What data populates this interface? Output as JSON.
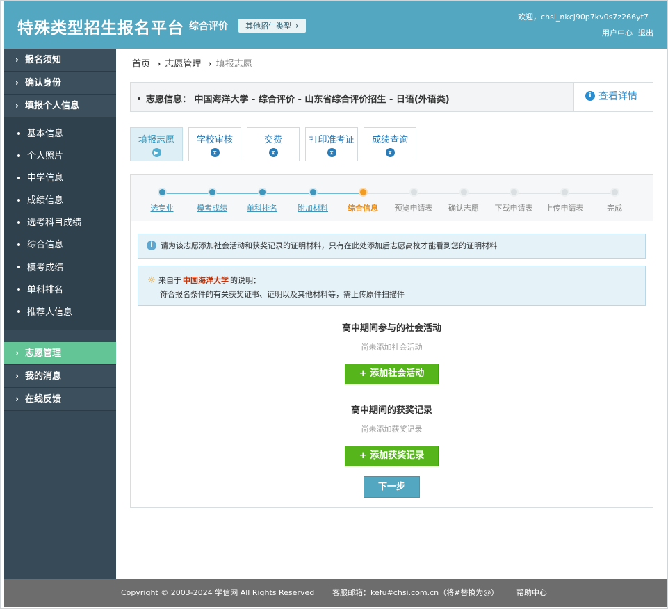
{
  "header": {
    "title": "特殊类型招生报名平台",
    "subtitle": "综合评价",
    "other_types": "其他招生类型",
    "welcome": "欢迎，chsi_nkcj90p7kv0s7z266yt7",
    "user_center": "用户中心",
    "logout": "退出"
  },
  "sidebar": {
    "top": [
      {
        "label": "报名须知"
      },
      {
        "label": "确认身份"
      },
      {
        "label": "填报个人信息"
      }
    ],
    "sub": [
      {
        "label": "基本信息"
      },
      {
        "label": "个人照片"
      },
      {
        "label": "中学信息"
      },
      {
        "label": "成绩信息"
      },
      {
        "label": "选考科目成绩"
      },
      {
        "label": "综合信息"
      },
      {
        "label": "模考成绩"
      },
      {
        "label": "单科排名"
      },
      {
        "label": "推荐人信息"
      }
    ],
    "bottom": [
      {
        "label": "志愿管理",
        "active": true
      },
      {
        "label": "我的消息"
      },
      {
        "label": "在线反馈"
      }
    ]
  },
  "breadcrumb": [
    "首页",
    "志愿管理",
    "填报志愿"
  ],
  "info_bar": {
    "text": "志愿信息： 中国海洋大学 - 综合评价 - 山东省综合评价招生 - 日语(外语类)",
    "detail": "查看详情"
  },
  "stage_tabs": [
    {
      "label": "填报志愿",
      "icon": "play-icon",
      "active": true
    },
    {
      "label": "学校审核",
      "icon": "hourglass-icon"
    },
    {
      "label": "交费",
      "icon": "hourglass-icon"
    },
    {
      "label": "打印准考证",
      "icon": "hourglass-icon"
    },
    {
      "label": "成绩查询",
      "icon": "hourglass-icon"
    }
  ],
  "steps": [
    {
      "label": "选专业",
      "state": "done"
    },
    {
      "label": "模考成绩",
      "state": "done"
    },
    {
      "label": "单科排名",
      "state": "done"
    },
    {
      "label": "附加材料",
      "state": "done"
    },
    {
      "label": "综合信息",
      "state": "current"
    },
    {
      "label": "预览申请表",
      "state": "todo"
    },
    {
      "label": "确认志愿",
      "state": "todo"
    },
    {
      "label": "下载申请表",
      "state": "todo"
    },
    {
      "label": "上传申请表",
      "state": "todo"
    },
    {
      "label": "完成",
      "state": "todo"
    }
  ],
  "tip": "请为该志愿添加社会活动和获奖记录的证明材料，只有在此处添加后志愿高校才能看到您的证明材料",
  "note": {
    "prefix": "来自于",
    "university": "中国海洋大学",
    "suffix": "的说明：",
    "body": "符合报名条件的有关获奖证书、证明以及其他材料等，需上传原件扫描件"
  },
  "activities": {
    "title": "高中期间参与的社会活动",
    "empty": "尚未添加社会活动",
    "button": "+ 添加社会活动"
  },
  "awards": {
    "title": "高中期间的获奖记录",
    "empty": "尚未添加获奖记录",
    "button": "+ 添加获奖记录"
  },
  "next_button": "下一步",
  "footer": {
    "copyright": "Copyright © 2003-2024 学信网 All Rights Reserved",
    "email": "客服邮箱：kefu#chsi.com.cn（将#替换为@）",
    "help": "帮助中心"
  },
  "colors": {
    "header_bg": "#53a7c1",
    "sidebar_bg": "#364a57",
    "sidebar_active": "#63c495",
    "step_done": "#3d95bb",
    "step_current": "#f19b21",
    "add_button": "#55b51b",
    "footer_bg": "#6d6d6d"
  }
}
